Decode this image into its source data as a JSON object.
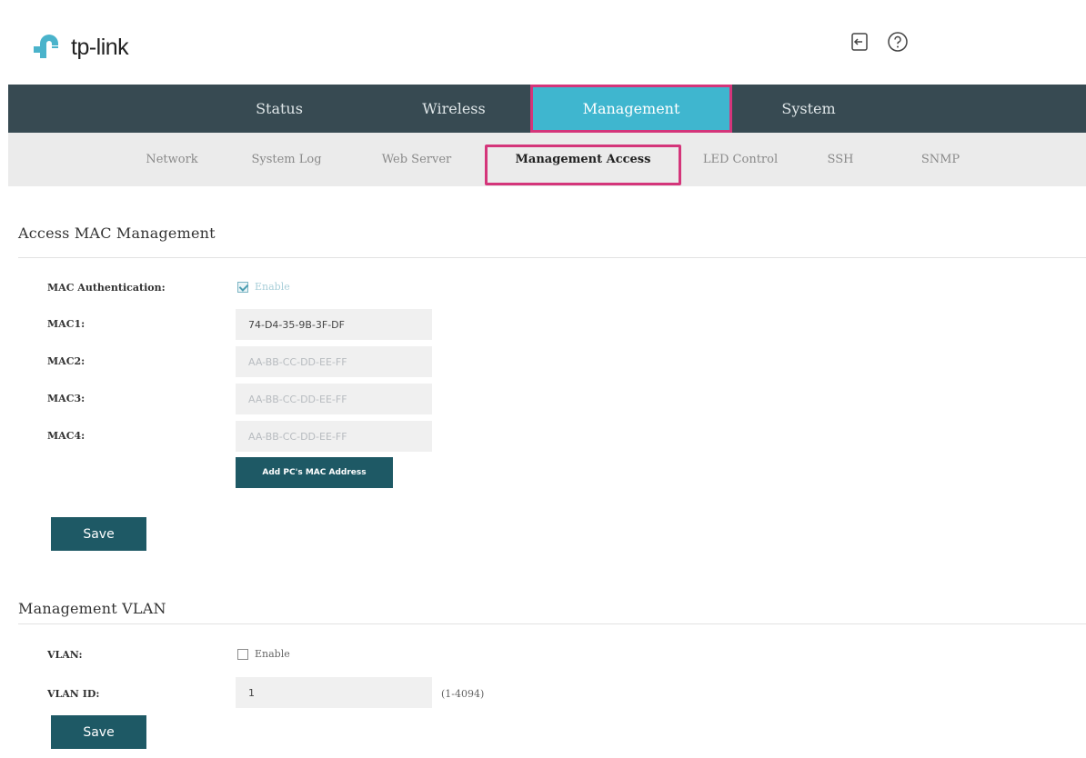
{
  "brand": {
    "logo_text": "tp-link",
    "accent_color": "#4ab3cb",
    "brand_color": "#3fb6cf"
  },
  "header": {
    "icons": [
      "logout-icon",
      "help-icon"
    ]
  },
  "main_nav": [
    {
      "label": "Status"
    },
    {
      "label": "Wireless"
    },
    {
      "label": "Management",
      "active": true
    },
    {
      "label": "System"
    }
  ],
  "sub_nav": [
    {
      "label": "Network"
    },
    {
      "label": "System Log"
    },
    {
      "label": "Web Server"
    },
    {
      "label": "Management Access",
      "active": true
    },
    {
      "label": "LED Control"
    },
    {
      "label": "SSH"
    },
    {
      "label": "SNMP"
    }
  ],
  "access_mac": {
    "title": "Access MAC Management",
    "auth_label": "MAC Authentication:",
    "enable_label": "Enable",
    "enable_checked": true,
    "fields": [
      {
        "label": "MAC1:",
        "value": "74-D4-35-9B-3F-DF",
        "placeholder": ""
      },
      {
        "label": "MAC2:",
        "value": "",
        "placeholder": "AA-BB-CC-DD-EE-FF"
      },
      {
        "label": "MAC3:",
        "value": "",
        "placeholder": "AA-BB-CC-DD-EE-FF"
      },
      {
        "label": "MAC4:",
        "value": "",
        "placeholder": "AA-BB-CC-DD-EE-FF"
      }
    ],
    "add_button": "Add PC's MAC Address",
    "save_button": "Save"
  },
  "mgmt_vlan": {
    "title": "Management VLAN",
    "vlan_label": "VLAN:",
    "enable_label": "Enable",
    "enable_checked": false,
    "vlan_id_label": "VLAN ID:",
    "vlan_id_value": "1",
    "vlan_id_hint": "(1-4094)",
    "save_button": "Save"
  }
}
